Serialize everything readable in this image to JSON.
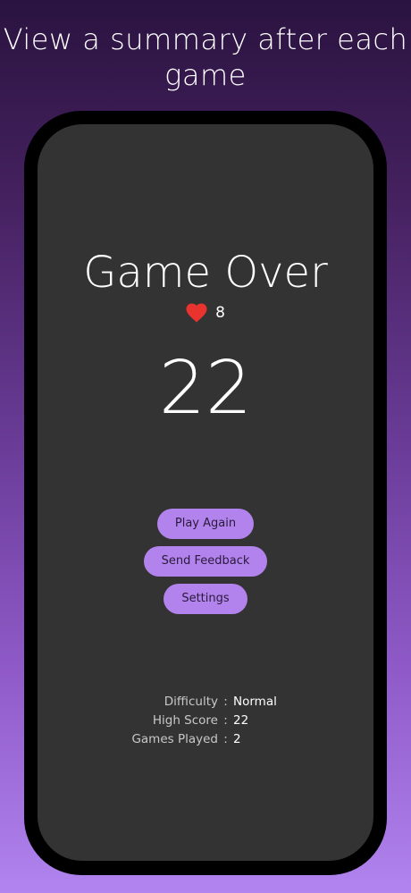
{
  "headline": {
    "line1": "View a summary after each",
    "line2": "game"
  },
  "game": {
    "title": "Game Over",
    "lives_icon": "heart-icon",
    "lives": "8",
    "score": "22"
  },
  "buttons": {
    "play_again": "Play Again",
    "send_feedback": "Send Feedback",
    "settings": "Settings"
  },
  "stats": [
    {
      "label": "Difficulty",
      "separator": ":",
      "value": "Normal"
    },
    {
      "label": "High Score",
      "separator": ":",
      "value": "22"
    },
    {
      "label": "Games Played",
      "separator": ":",
      "value": "2"
    }
  ],
  "colors": {
    "accent": "#b283ec",
    "heart": "#e8332e",
    "screen_bg": "#333333"
  }
}
